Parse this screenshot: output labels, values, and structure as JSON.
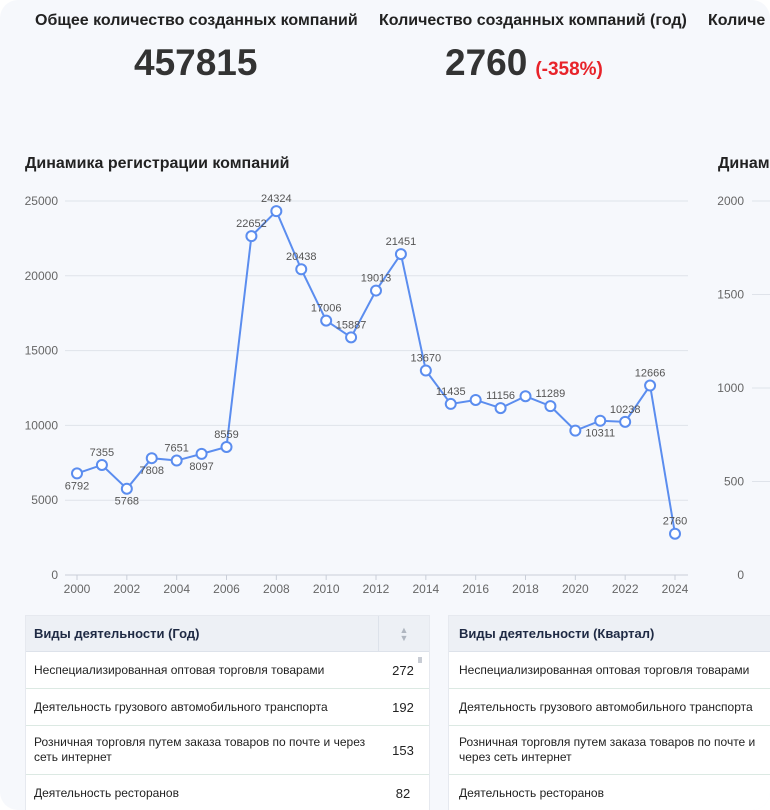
{
  "kpis": {
    "total": {
      "label": "Общее количество созданных компаний",
      "value": "457815"
    },
    "year": {
      "label": "Количество созданных компаний (год)",
      "value": "2760",
      "change": "(-358%)"
    },
    "third": {
      "label": "Количе"
    }
  },
  "chart": {
    "title": "Динамика регистрации компаний",
    "right_title": "Динам"
  },
  "chart_data": [
    {
      "type": "line",
      "title": "Динамика регистрации компаний",
      "xlabel": "",
      "ylabel": "",
      "ylim": [
        0,
        25000
      ],
      "y_ticks": [
        0,
        5000,
        10000,
        15000,
        20000,
        25000
      ],
      "x_ticks": [
        2000,
        2002,
        2004,
        2006,
        2008,
        2010,
        2012,
        2014,
        2016,
        2018,
        2020,
        2022,
        2024
      ],
      "grid": true,
      "color": "#5b8def",
      "x": [
        2000,
        2001,
        2002,
        2003,
        2004,
        2005,
        2006,
        2007,
        2008,
        2009,
        2010,
        2011,
        2012,
        2013,
        2014,
        2015,
        2016,
        2017,
        2018,
        2019,
        2020,
        2021,
        2022,
        2023,
        2024
      ],
      "values": [
        6792,
        7355,
        5768,
        7808,
        7651,
        8097,
        8559,
        22652,
        24324,
        20438,
        17006,
        15887,
        19013,
        21451,
        13670,
        11435,
        11700,
        11156,
        11950,
        11289,
        9650,
        10311,
        10238,
        12666,
        2760
      ],
      "labels": [
        "6792",
        "7355",
        "5768",
        "7808",
        "7651",
        "8097",
        "8559",
        "22652",
        "24324",
        "20438",
        "17006",
        "15887",
        "19013",
        "21451",
        "13670",
        "11435",
        "",
        "11156",
        "",
        "11289",
        "",
        "10311",
        "10238",
        "12666",
        "2760"
      ]
    },
    {
      "type": "line",
      "title": "Динам",
      "y_ticks_visible": [
        "0",
        "500",
        "1000",
        "1500",
        "2000"
      ]
    }
  ],
  "table_year": {
    "header": "Виды деятельности (Год)",
    "sort_icon": "sort-arrows-icon",
    "rows": [
      {
        "name": "Неспециализированная оптовая торговля товарами",
        "value": "272"
      },
      {
        "name": "Деятельность грузового автомобильного транспорта",
        "value": "192"
      },
      {
        "name": "Розничная торговля путем заказа товаров по почте и через сеть интернет",
        "value": "153"
      },
      {
        "name": "Деятельность ресторанов",
        "value": "82"
      }
    ]
  },
  "table_quarter": {
    "header": "Виды деятельности (Квартал)",
    "rows": [
      {
        "name": "Неспециализированная оптовая торговля товарами"
      },
      {
        "name": "Деятельность грузового автомобильного транспорта"
      },
      {
        "name": "Розничная торговля путем заказа товаров по почте и через сеть интернет"
      },
      {
        "name": "Деятельность ресторанов"
      }
    ]
  }
}
